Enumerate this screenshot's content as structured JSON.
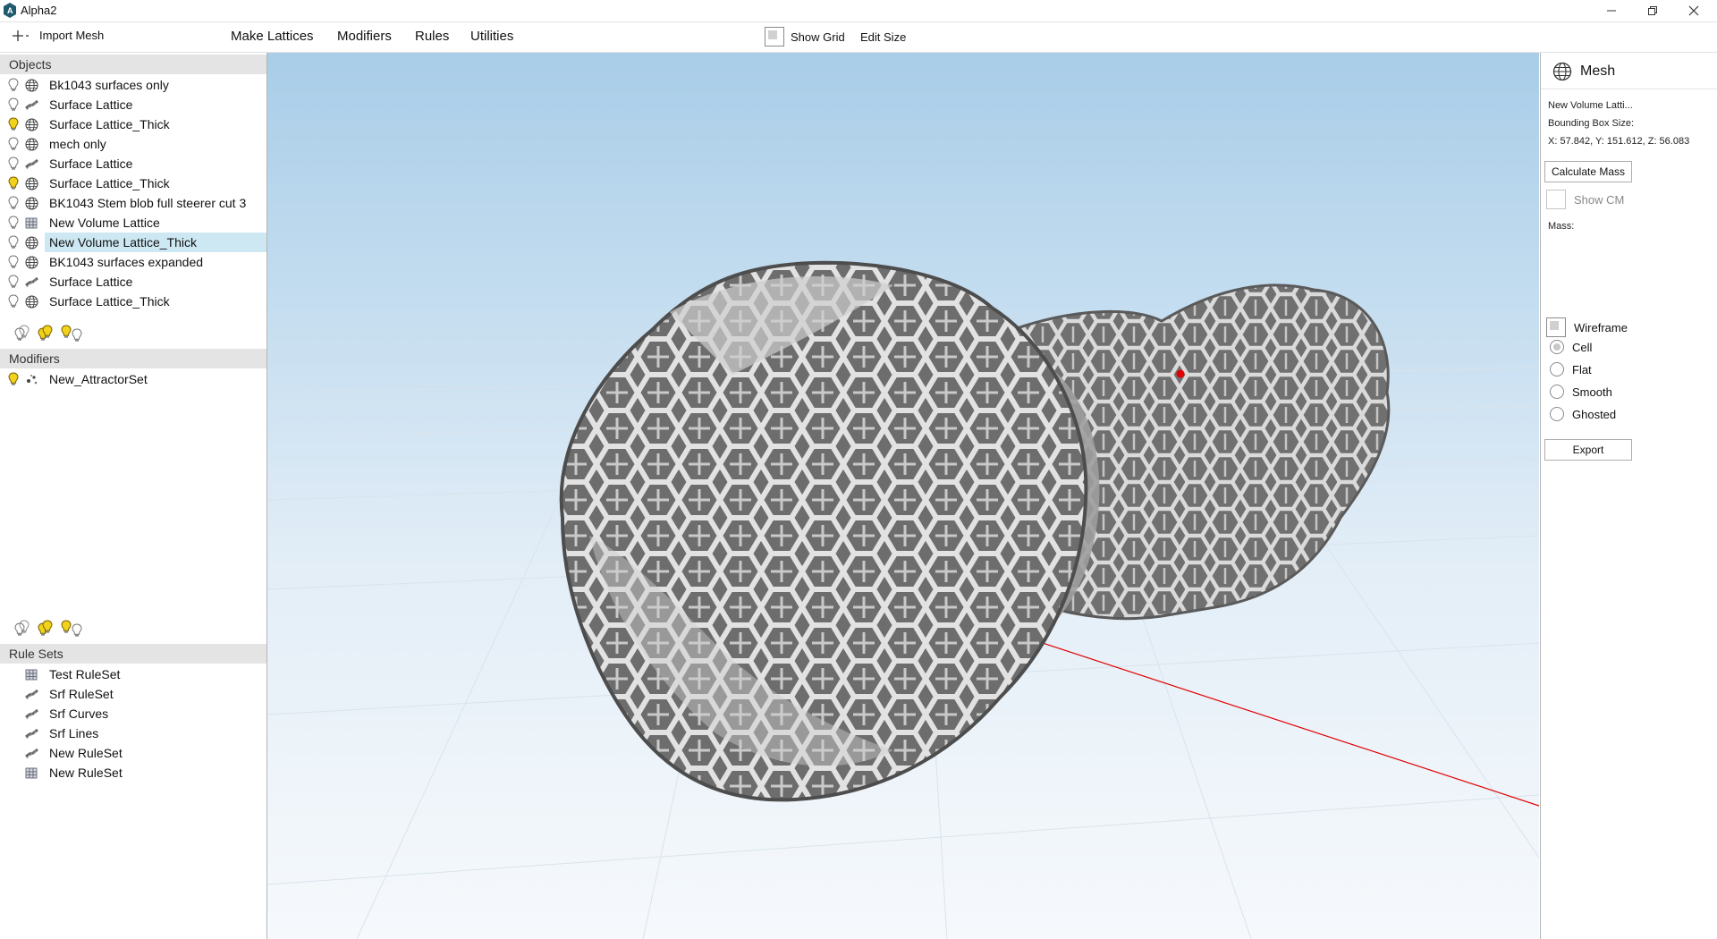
{
  "app": {
    "title": "Alpha2"
  },
  "toolbar": {
    "import_label": "Import Mesh",
    "menus": [
      "Make Lattices",
      "Modifiers",
      "Rules",
      "Utilities"
    ],
    "show_grid_label": "Show Grid",
    "edit_size_label": "Edit Size"
  },
  "objects": {
    "header": "Objects",
    "items": [
      {
        "label": "Bk1043 surfaces only",
        "icon": "globe-icon",
        "light": false
      },
      {
        "label": "Surface Lattice",
        "icon": "lattice-strip-icon",
        "light": false
      },
      {
        "label": "Surface Lattice_Thick",
        "icon": "globe-icon",
        "light": true
      },
      {
        "label": "mech only",
        "icon": "globe-icon",
        "light": false
      },
      {
        "label": "Surface Lattice",
        "icon": "lattice-strip-icon",
        "light": false
      },
      {
        "label": "Surface Lattice_Thick",
        "icon": "globe-icon",
        "light": true
      },
      {
        "label": "BK1043 Stem blob full steerer cut 3",
        "icon": "globe-icon",
        "light": false
      },
      {
        "label": "New Volume Lattice",
        "icon": "volume-lattice-icon",
        "light": false
      },
      {
        "label": "New Volume Lattice_Thick",
        "icon": "globe-icon",
        "light": false,
        "selected": true
      },
      {
        "label": "BK1043 surfaces expanded",
        "icon": "globe-icon",
        "light": false
      },
      {
        "label": "Surface Lattice",
        "icon": "lattice-strip-icon",
        "light": false
      },
      {
        "label": "Surface Lattice_Thick",
        "icon": "globe-icon",
        "light": false
      }
    ]
  },
  "modifiers": {
    "header": "Modifiers",
    "items": [
      {
        "label": "New_AttractorSet",
        "icon": "attractor-icon",
        "light": true
      }
    ]
  },
  "rulesets": {
    "header": "Rule Sets",
    "items": [
      {
        "label": "Test RuleSet",
        "icon": "volume-lattice-icon"
      },
      {
        "label": "Srf RuleSet",
        "icon": "lattice-strip-icon"
      },
      {
        "label": "Srf Curves",
        "icon": "lattice-strip-icon"
      },
      {
        "label": "Srf Lines",
        "icon": "lattice-strip-icon"
      },
      {
        "label": "New RuleSet",
        "icon": "lattice-strip-icon"
      },
      {
        "label": "New RuleSet",
        "icon": "volume-lattice-icon"
      }
    ]
  },
  "mesh_panel": {
    "title": "Mesh",
    "name": "New Volume Latti...",
    "bbox_label": "Bounding Box Size:",
    "bbox_value": "X: 57.842, Y: 151.612, Z: 56.083",
    "calc_mass_label": "Calculate Mass",
    "show_cm_label": "Show CM",
    "mass_label": "Mass:",
    "wireframe_label": "Wireframe",
    "render_modes": [
      "Cell",
      "Flat",
      "Smooth",
      "Ghosted"
    ],
    "selected_mode": "Cell",
    "export_label": "Export"
  },
  "colors": {
    "selection": "#cde8f2",
    "bulb_on": "#f2d21b",
    "x_axis": "#e00000",
    "y_axis": "#00cc00",
    "sky_top": "#a9cde8"
  }
}
